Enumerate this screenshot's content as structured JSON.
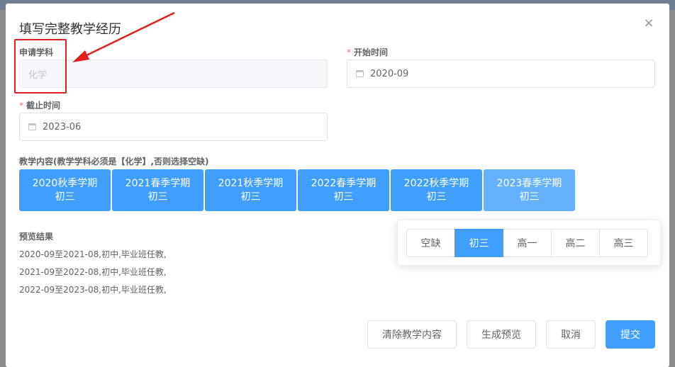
{
  "dialog": {
    "title": "填写完整教学经历",
    "close_glyph": "×"
  },
  "form": {
    "subject": {
      "label": "申请学科",
      "value": "化学"
    },
    "start_time": {
      "required_mark": "*",
      "label": "开始时间",
      "value": "2020-09"
    },
    "end_time": {
      "required_mark": "*",
      "label": "截止时间",
      "value": "2023-06"
    },
    "content_label": "教学内容(教学学科必须是【化学】,否则选择空缺)"
  },
  "terms": [
    {
      "semester": "2020秋季学期",
      "grade": "初三"
    },
    {
      "semester": "2021春季学期",
      "grade": "初三"
    },
    {
      "semester": "2021秋季学期",
      "grade": "初三"
    },
    {
      "semester": "2022春季学期",
      "grade": "初三"
    },
    {
      "semester": "2022秋季学期",
      "grade": "初三"
    },
    {
      "semester": "2023春季学期",
      "grade": "初三"
    }
  ],
  "grade_options": [
    "空缺",
    "初三",
    "高一",
    "高二",
    "高三"
  ],
  "selected_grade": "初三",
  "preview": {
    "title": "预览结果",
    "lines": [
      "2020-09至2021-08,初中,毕业班任教,",
      "2021-09至2022-08,初中,毕业班任教,",
      "2022-09至2023-08,初中,毕业班任教,"
    ]
  },
  "buttons": {
    "clear": "清除教学内容",
    "preview": "生成预览",
    "cancel": "取消",
    "submit": "提交"
  },
  "colors": {
    "primary": "#409eff",
    "primary_light": "#66b1ff",
    "annotation_red": "#e02020",
    "required": "#f56c6c"
  }
}
